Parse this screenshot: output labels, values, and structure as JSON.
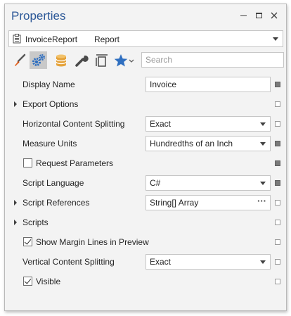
{
  "window": {
    "title": "Properties"
  },
  "selector": {
    "object_name": "InvoiceReport",
    "object_type": "Report"
  },
  "toolbar": {
    "buttons": [
      {
        "icon": "brush-icon",
        "active": false
      },
      {
        "icon": "gears-icon",
        "active": true
      },
      {
        "icon": "database-icon",
        "active": false
      },
      {
        "icon": "wrench-icon",
        "active": false
      },
      {
        "icon": "band-layout-icon",
        "active": false
      },
      {
        "icon": "star-icon",
        "active": false
      }
    ],
    "search_placeholder": "Search"
  },
  "properties": [
    {
      "label": "Display Name",
      "value": "Invoice",
      "editor": "text",
      "marker": "set"
    },
    {
      "label": "Export Options",
      "expandable": true,
      "marker": "empty"
    },
    {
      "label": "Horizontal Content Splitting",
      "value": "Exact",
      "editor": "dropdown",
      "marker": "empty"
    },
    {
      "label": "Measure Units",
      "value": "Hundredths of an Inch",
      "editor": "dropdown",
      "marker": "set"
    },
    {
      "label": "Request Parameters",
      "checkbox": true,
      "checked": false,
      "marker": "set"
    },
    {
      "label": "Script Language",
      "value": "C#",
      "editor": "dropdown",
      "marker": "set"
    },
    {
      "label": "Script References",
      "value": "String[] Array",
      "editor": "ellipsis",
      "expandable": true,
      "marker": "empty"
    },
    {
      "label": "Scripts",
      "expandable": true,
      "marker": "empty"
    },
    {
      "label": "Show Margin Lines in Preview",
      "checkbox": true,
      "checked": true,
      "marker": "empty"
    },
    {
      "label": "Vertical Content Splitting",
      "value": "Exact",
      "editor": "dropdown",
      "marker": "empty"
    },
    {
      "label": "Visible",
      "checkbox": true,
      "checked": true,
      "marker": "empty"
    }
  ],
  "colors": {
    "title": "#2b5797",
    "active_tool": "#c9c9c9",
    "brush": "#e2611d",
    "gear": "#2f6fc0",
    "database": "#e5a33c",
    "star": "#2f6fc0"
  }
}
